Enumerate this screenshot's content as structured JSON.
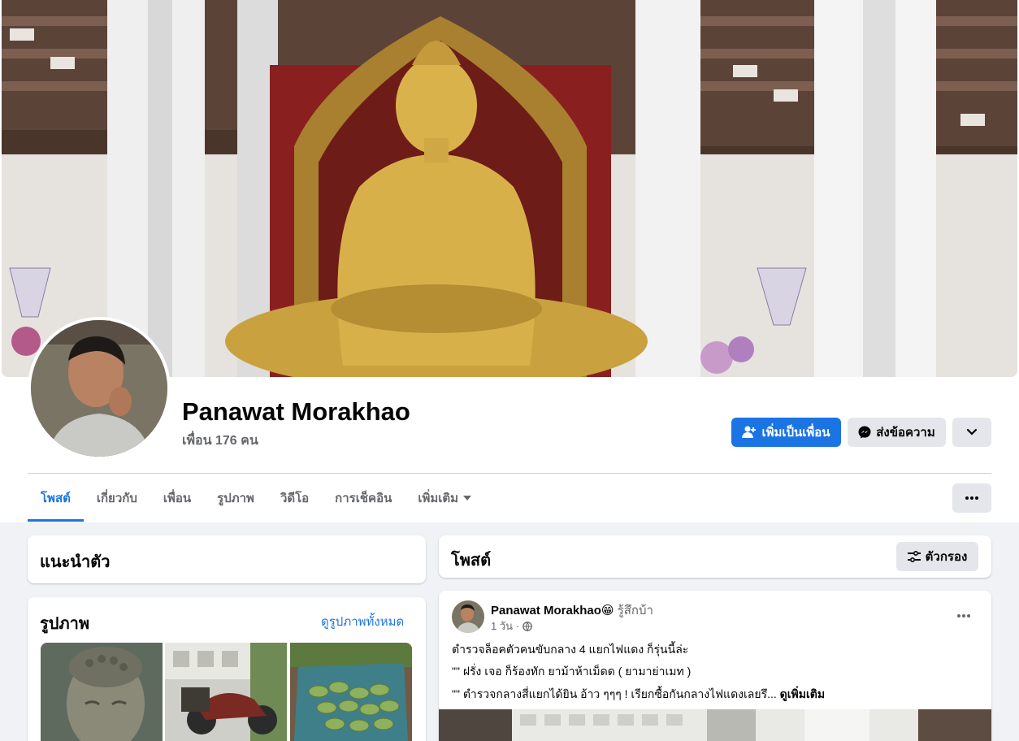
{
  "profile": {
    "name": "Panawat Morakhao",
    "friends": "เพื่อน 176 คน"
  },
  "actions": {
    "add_friend": "เพิ่มเป็นเพื่อน",
    "message": "ส่งข้อความ",
    "more_icon": "chevron-down-icon"
  },
  "tabs": [
    {
      "label": "โพสต์",
      "active": true
    },
    {
      "label": "เกี่ยวกับ"
    },
    {
      "label": "เพื่อน"
    },
    {
      "label": "รูปภาพ"
    },
    {
      "label": "วิดีโอ"
    },
    {
      "label": "การเช็คอิน"
    },
    {
      "label": "เพิ่มเติม"
    }
  ],
  "tabs_more_icon": "ellipsis-icon",
  "intro": {
    "title": "แนะนำตัว"
  },
  "photos": {
    "title": "รูปภาพ",
    "see_all": "ดูรูปภาพทั้งหมด"
  },
  "posts_header": {
    "title": "โพสต์",
    "filter": "ตัวกรอง"
  },
  "post": {
    "author": "Panawat Morakhao",
    "feeling_emoji": "😁",
    "feeling": "รู้สึกบ้า",
    "time": "1 วัน ·",
    "privacy_icon": "globe-icon",
    "lines": [
      "ตำรวจล็อคตัวคนขับกลาง 4 แยกไฟแดง  ก็รุ่นนี้ล่ะ",
      "\"\"  ฝรั่ง เจอ ก็ร้องทัก ยาม้าห้าเม็ดด  ( ยามาย่าเมท )",
      "\"\"  ตำรวจกลางสี่แยกได้ยิน   อ้าว ๆๆๆ !  เรียกซื้อกันกลางไฟแดงเลยรึ..."
    ],
    "see_more": "ดูเพิ่มเติม"
  },
  "colors": {
    "accent": "#1b74e4",
    "background": "#f0f2f5",
    "secondary_button": "#e4e6eb"
  }
}
